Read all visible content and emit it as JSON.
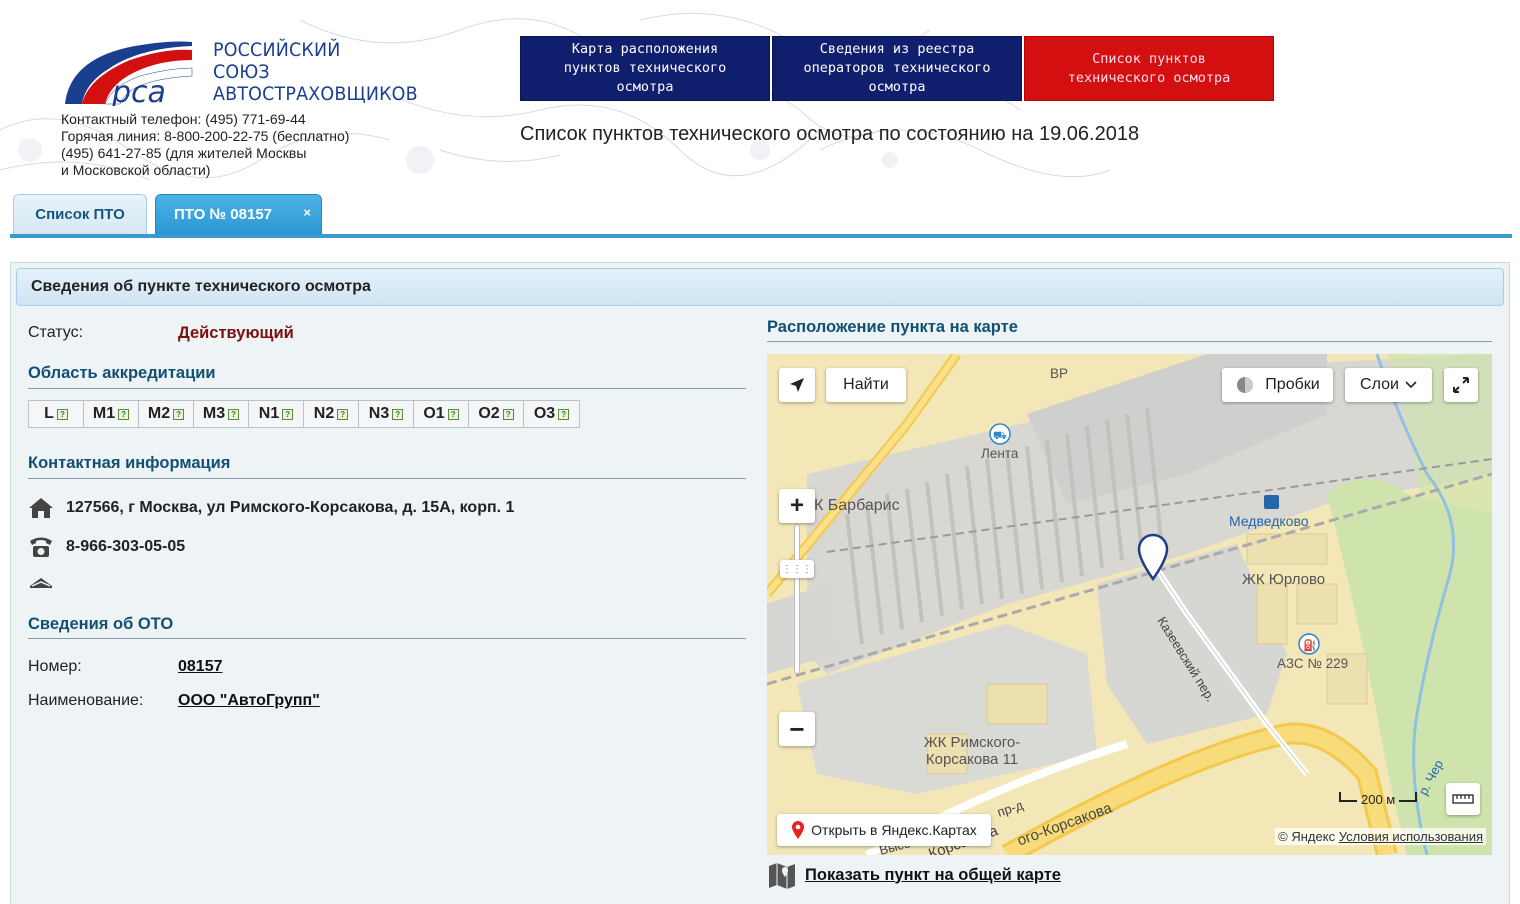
{
  "header": {
    "logo_title": [
      "РОССИЙСКИЙ",
      "СОЮЗ",
      "АВТОСТРАХОВЩИКОВ"
    ],
    "logo_abbr": "рса",
    "contacts": [
      "Контактный телефон:  (495) 771-69-44",
      "Горячая линия:  8-800-200-22-75  (бесплатно)",
      "(495) 641-27-85 (для жителей Москвы",
      "и Московской области)"
    ],
    "nav": [
      {
        "label": "Карта расположения пунктов технического осмотра"
      },
      {
        "label": "Сведения из реестра операторов технического осмотра"
      },
      {
        "label": "Список пунктов технического осмотра"
      }
    ],
    "subtitle": "Список пунктов технического осмотра по состоянию на 19.06.2018",
    "colors": {
      "nav_blue": "#0f1f6e",
      "nav_red": "#d40f0f",
      "logo_blue": "#1b3f8f"
    }
  },
  "tabs": [
    {
      "label": "Список ПТО",
      "active": false
    },
    {
      "label": "ПТО № 08157",
      "active": true,
      "close": "×"
    }
  ],
  "panel": {
    "title": "Сведения об пункте технического осмотра",
    "status_label": "Статус:",
    "status_value": "Действующий",
    "accreditation_title": "Область аккредитации",
    "categories": [
      "L",
      "M1",
      "M2",
      "M3",
      "N1",
      "N2",
      "N3",
      "O1",
      "O2",
      "O3"
    ],
    "category_icon": "?",
    "contacts_title": "Контактная информация",
    "address": "127566, г Москва, ул Римского-Корсакова, д. 15А, корп. 1",
    "phone": "8-966-303-05-05",
    "oto_title": "Сведения об ОТО",
    "oto_number_label": "Номер:",
    "oto_number": "08157",
    "oto_name_label": "Наименование:",
    "oto_name": "ООО \"АвтоГрупп\""
  },
  "map": {
    "title": "Расположение пункта на карте",
    "find_button": "Найти",
    "traffic_button": "Пробки",
    "layers_button": "Слои",
    "zoom_in": "+",
    "zoom_out": "−",
    "open_in_yandex": "Открыть в Яндекс.Картах",
    "attribution": "© Яндекс",
    "terms": "Условия использования",
    "scale": "200 м",
    "labels": {
      "bp": "BP",
      "lenta": "Лента",
      "barbaris": "К Барбарис",
      "medvedkovo": "Медведково",
      "jk_yurlovo": "ЖК Юрлово",
      "kazeevsky": "Казеевский пер.",
      "azs": "АЗС № 229",
      "jk_rimskogo": "ЖК Римского-Корсакова 11",
      "street_pr": "пр-д",
      "street_vys": "Высо",
      "street_rk": "ого-Корсакова",
      "street_rk2": "Корсакова",
      "river": "р. Чер"
    },
    "show_on_general_map": "Показать пункт на общей карте",
    "icons": [
      "locate-icon",
      "traffic-icon",
      "chevron-down-icon",
      "fullscreen-icon",
      "ruler-icon",
      "map-pin-icon",
      "placemark-icon",
      "map-book-icon"
    ]
  }
}
